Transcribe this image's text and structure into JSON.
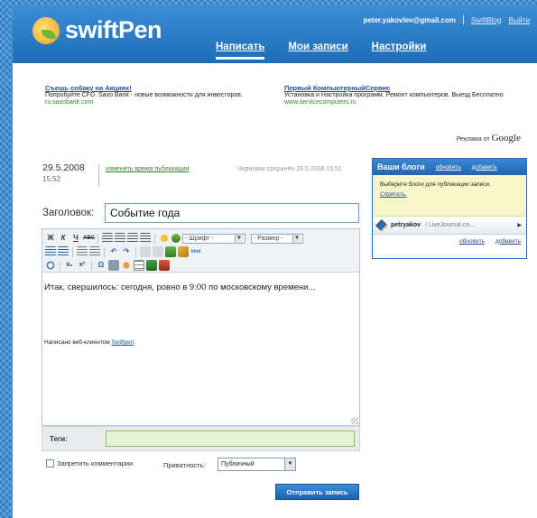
{
  "app": {
    "name": "swiftPen"
  },
  "header": {
    "user_email": "peter.yakovlev@gmail.com",
    "links": [
      "SwiftBlog",
      "Выйти"
    ],
    "nav": [
      "Написать",
      "Мои записи",
      "Настройки"
    ]
  },
  "ads": [
    {
      "title": "Съешь собаку на Акциях!",
      "text": "Попробуйте CFD. Saxo Bank - новые возможности для инвесторов.",
      "url": "ru.saxobank.com"
    },
    {
      "title": "Первый КомпьютерныйСервис",
      "text": "Установка и Настройка программ. Ремонт компьютеров. Выезд Бесплатно",
      "url": "www.servicecomputers.ru"
    }
  ],
  "google_ads": {
    "prefix": "Реклама от",
    "brand": "Google"
  },
  "post": {
    "date": "29.5.2008",
    "time": "15:52",
    "change_time_link": "изменить время публикации",
    "draft_saved": "Черновик сохранён 29.5.2008 15:51",
    "title_label": "Заголовок:",
    "title_value": "Событие года",
    "body": "Итак, свершилось: сегодня, ровно в 9:00 по московскому времени...",
    "signature_prefix": "Написано веб-клиентом ",
    "signature_link": "Swiftpen",
    "signature_suffix": "."
  },
  "toolbar": {
    "row1": [
      "Ж",
      "К",
      "Ч",
      "ABC"
    ],
    "font_select": "- Шрифт -",
    "size_select": "- Размер -",
    "special": "Ω"
  },
  "tags": {
    "label": "Теги:",
    "value": ""
  },
  "options": {
    "no_comments_label": "Запретить комментарии",
    "privacy_label": "Приватность:",
    "privacy_value": "Публичный",
    "submit_label": "Отправить запись"
  },
  "blogs": {
    "title": "Ваши блоги",
    "refresh": "обновить",
    "add": "добавить",
    "hint": "Выберите блоги для публикации записи.",
    "hint_link": "Спрятать.",
    "item_name": "petryakov",
    "item_host": "/ LiveJournal.co..."
  }
}
